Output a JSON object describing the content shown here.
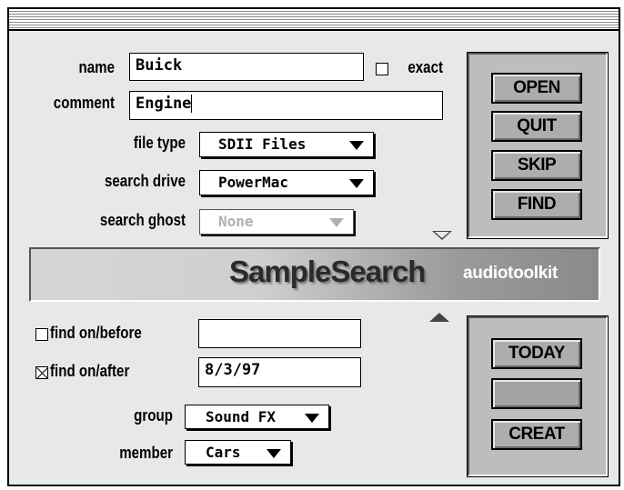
{
  "search": {
    "name_label": "name",
    "name_value": "Buick",
    "exact_label": "exact",
    "exact_checked": false,
    "comment_label": "comment",
    "comment_value": "Engine",
    "file_type_label": "file type",
    "file_type_value": "SDII Files",
    "search_drive_label": "search drive",
    "search_drive_value": "PowerMac",
    "search_ghost_label": "search ghost",
    "search_ghost_value": "None"
  },
  "top_buttons": {
    "open": "OPEN",
    "quit": "QUIT",
    "skip": "SKIP",
    "find": "FIND"
  },
  "banner": {
    "title": "SampleSearch",
    "subtitle": "audiotoolkit"
  },
  "date_filter": {
    "before_label": "find on/before",
    "before_checked": false,
    "before_value": "",
    "after_label": "find on/after",
    "after_checked": true,
    "after_value": "8/3/97"
  },
  "grouping": {
    "group_label": "group",
    "group_value": "Sound FX",
    "member_label": "member",
    "member_value": "Cars"
  },
  "bottom_buttons": {
    "today": "TODAY",
    "blank": "",
    "creat": "CREAT"
  },
  "icons": {
    "collapse": "triangle-down-icon",
    "expand": "triangle-up-icon"
  }
}
